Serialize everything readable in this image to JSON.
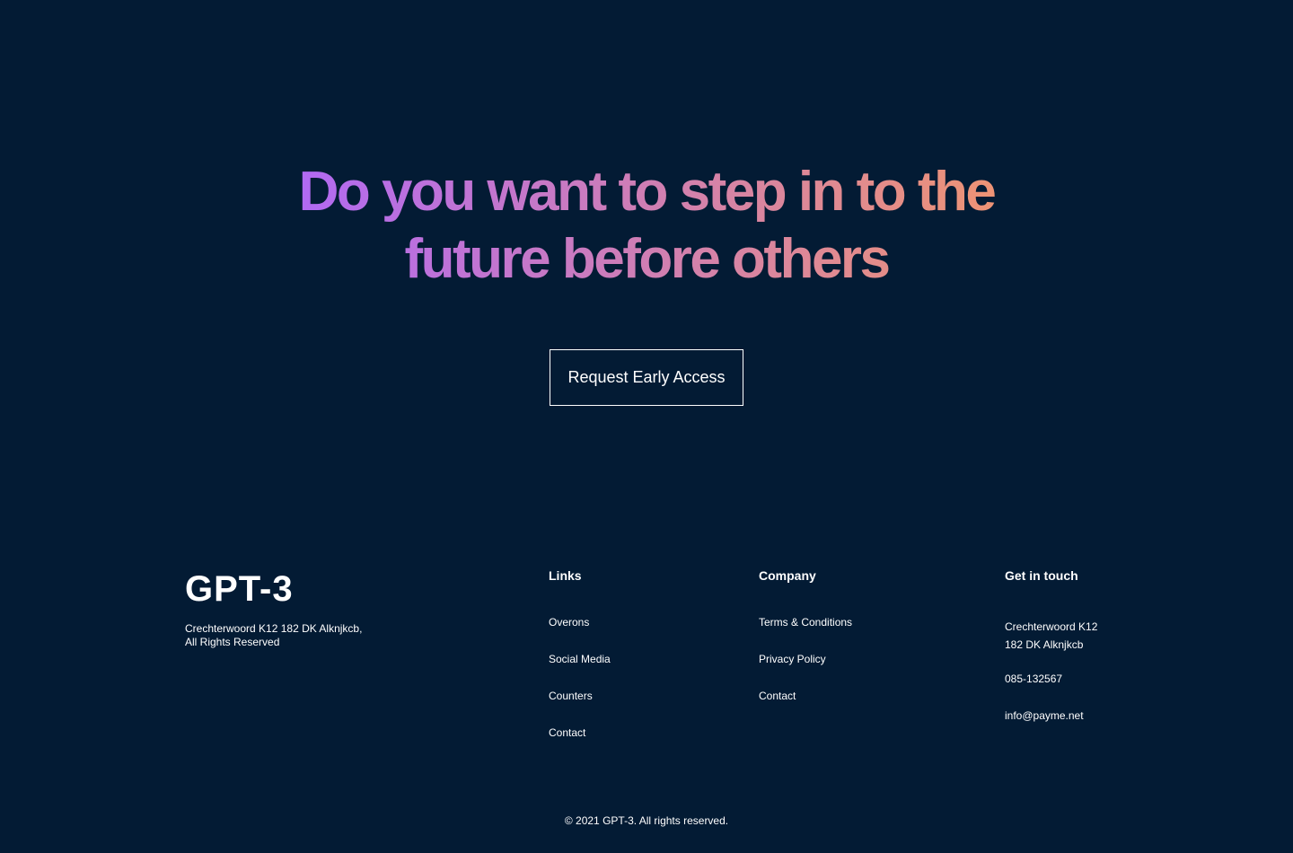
{
  "hero": {
    "headline": "Do you want to step in to the future before others",
    "cta_label": "Request Early Access"
  },
  "footer": {
    "logo": "GPT-3",
    "address": "Crechterwoord K12 182 DK Alknjkcb, All Rights Reserved",
    "links": {
      "title": "Links",
      "items": [
        "Overons",
        "Social Media",
        "Counters",
        "Contact"
      ]
    },
    "company": {
      "title": "Company",
      "items": [
        "Terms & Conditions",
        "Privacy Policy",
        "Contact"
      ]
    },
    "contact": {
      "title": "Get in touch",
      "address": "Crechterwoord K12 182 DK Alknjkcb",
      "phone": "085-132567",
      "email": "info@payme.net"
    },
    "copyright": "© 2021 GPT-3. All rights reserved."
  },
  "colors": {
    "background": "#031b34",
    "gradient_start": "#ae67fa",
    "gradient_end": "#f49867",
    "text": "#ffffff"
  }
}
